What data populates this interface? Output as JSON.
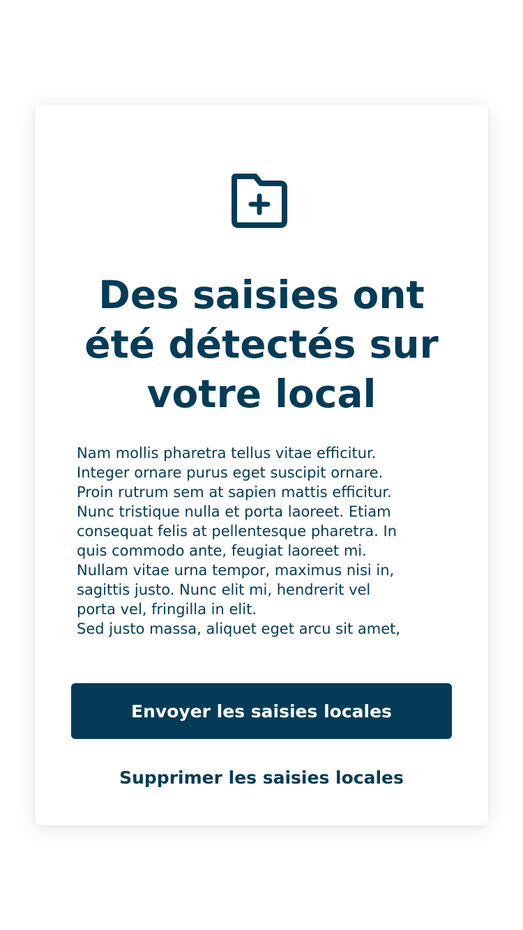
{
  "colors": {
    "primary": "#043c57",
    "background": "#ffffff",
    "button_text": "#ffffff"
  },
  "dialog": {
    "icon": "folder-plus-icon",
    "title": "Des saisies ont été détectés sur votre local",
    "body": "Nam mollis pharetra tellus vitae efficitur.\nInteger ornare purus eget suscipit ornare.\nProin rutrum sem at sapien mattis efficitur.\nNunc tristique nulla et porta laoreet. Etiam\nconsequat felis at pellentesque pharetra. In\nquis commodo ante, feugiat laoreet mi.\nNullam vitae urna tempor, maximus nisi in,\nsagittis justo. Nunc elit mi, hendrerit vel\nporta vel, fringilla in elit.\nSed justo massa, aliquet eget arcu sit amet,",
    "primary_button": "Envoyer les saisies locales",
    "secondary_button": "Supprimer les saisies locales"
  }
}
